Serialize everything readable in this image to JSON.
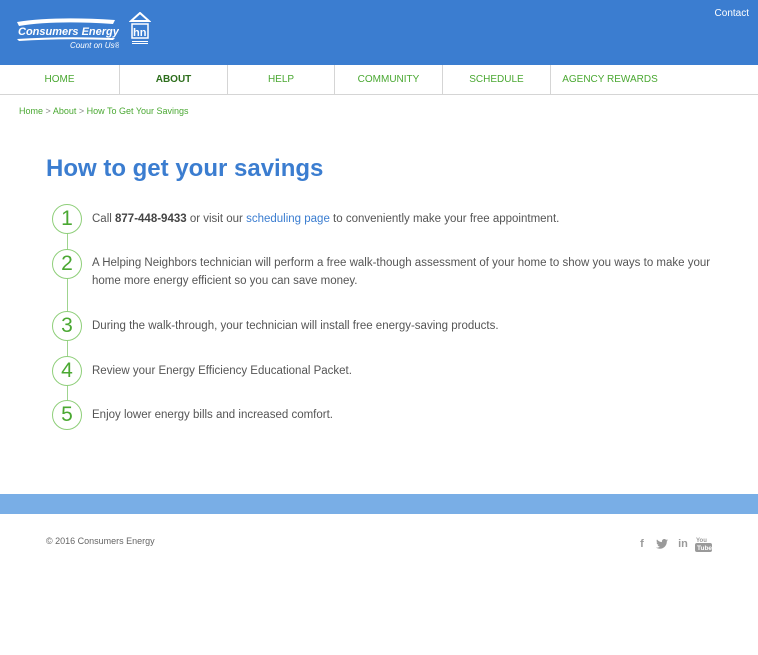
{
  "header": {
    "logo_alt": "Consumers Energy Count on Us",
    "contact_label": "Contact"
  },
  "nav": {
    "items": [
      {
        "label": "Home"
      },
      {
        "label": "About",
        "active": true
      },
      {
        "label": "Help"
      },
      {
        "label": "Community"
      },
      {
        "label": "Schedule"
      },
      {
        "label": "Agency Rewards"
      }
    ]
  },
  "breadcrumb": {
    "home": "Home",
    "about": "About",
    "current": "How To Get Your Savings",
    "separator": ">"
  },
  "main": {
    "title": "How to get your savings",
    "steps": [
      {
        "number": "1",
        "prefix": "Call ",
        "phone": "877-448-9433",
        "middle": " or visit our ",
        "link": "scheduling page",
        "suffix": " to conveniently make your free appointment."
      },
      {
        "number": "2",
        "text": "A Helping Neighbors technician will perform a free walk-though assessment of your home to show you ways to make your home more energy efficient so you can save money."
      },
      {
        "number": "3",
        "text": "During the walk-through, your technician will install free energy-saving products."
      },
      {
        "number": "4",
        "text": "Review your Energy Efficiency Educational Packet."
      },
      {
        "number": "5",
        "text": "Enjoy lower energy bills and increased comfort."
      }
    ]
  },
  "footer": {
    "copyright": "© 2016 Consumers Energy",
    "social": [
      "facebook-icon",
      "twitter-icon",
      "linkedin-icon",
      "youtube-icon"
    ]
  },
  "colors": {
    "brand_blue": "#3b7dd0",
    "band_blue": "#79aee6",
    "nav_green": "#4aa832"
  }
}
